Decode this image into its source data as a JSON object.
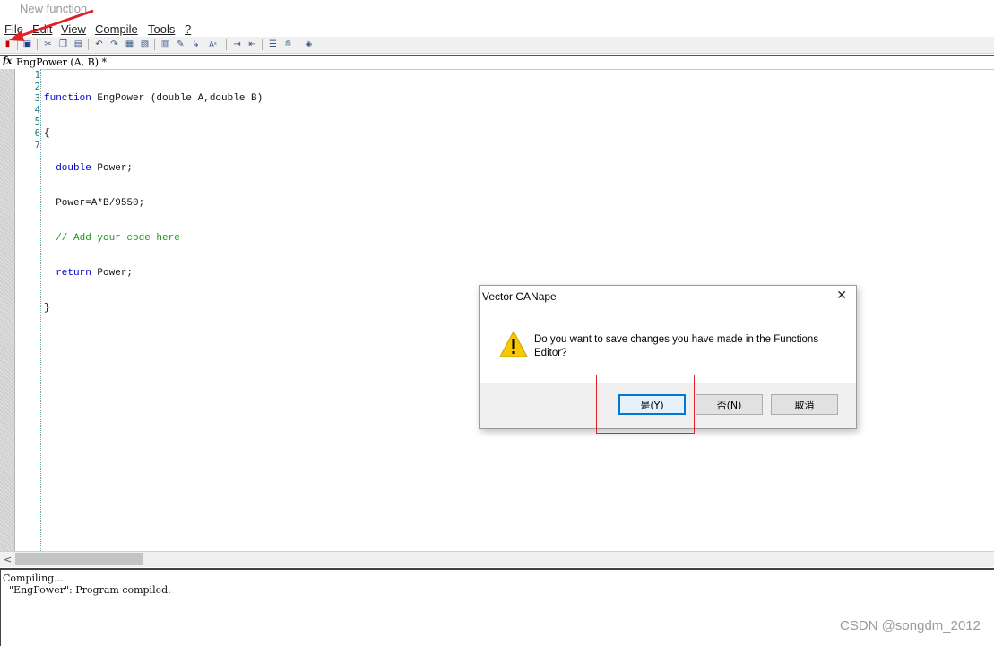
{
  "window": {
    "title": "New function"
  },
  "menu": {
    "items": [
      "File",
      "Edit",
      "View",
      "Compile",
      "Tools",
      "?"
    ]
  },
  "toolbar": {
    "buttons": [
      "exit",
      "save",
      "cut",
      "copy",
      "paste",
      "undo",
      "redo",
      "find",
      "replace",
      "compile",
      "check",
      "step",
      "text-case",
      "indent",
      "outdent",
      "comment",
      "uncomment",
      "help"
    ]
  },
  "editor": {
    "tab_label": "EngPower (A, B) *",
    "tab_icon": "fx-icon",
    "line_numbers": [
      "1",
      "2",
      "3",
      "4",
      "5",
      "6",
      "7"
    ],
    "lines": [
      {
        "keyword": "function",
        "text": " EngPower (double A,double B)"
      },
      {
        "keyword": "",
        "text": "{"
      },
      {
        "keyword": "  double",
        "text": " Power;"
      },
      {
        "keyword": "",
        "text": "  Power=A*B/9550;"
      },
      {
        "comment": "  // Add your code here"
      },
      {
        "keyword": "  return",
        "text": " Power;"
      },
      {
        "keyword": "",
        "text": "}"
      }
    ]
  },
  "output": {
    "lines": [
      "Compiling...",
      "  \"EngPower\": Program compiled."
    ]
  },
  "dialog": {
    "title": "Vector CANape",
    "close_symbol": "✕",
    "message": "Do you want to save changes you have made in the Functions Editor?",
    "buttons": {
      "yes": "是(Y)",
      "no": "否(N)",
      "cancel": "取消"
    }
  },
  "watermark": "CSDN @songdm_2012",
  "colors": {
    "annotation": "#e0212a",
    "keyword": "#0000c8",
    "comment": "#1a9a1a"
  }
}
